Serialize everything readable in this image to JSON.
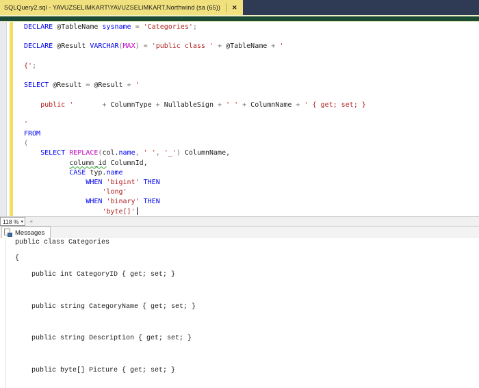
{
  "window": {
    "tab_title": "SQLQuery2.sql - YAVUZSELIMKART\\YAVUZSELIMKART.Northwind (sa (65))",
    "close_glyph": "✕"
  },
  "editor": {
    "zoom_level": "118 %",
    "zoom_dropdown_glyph": "▾",
    "scroll_left_glyph": "◄",
    "lines": [
      [
        {
          "t": "DECLARE",
          "c": "kw"
        },
        {
          "t": " @TableName ",
          "c": "id"
        },
        {
          "t": "sysname",
          "c": "kw"
        },
        {
          "t": " = ",
          "c": "op"
        },
        {
          "t": "'Categories'",
          "c": "str"
        },
        {
          "t": ";",
          "c": "op"
        }
      ],
      [],
      [
        {
          "t": "DECLARE",
          "c": "kw"
        },
        {
          "t": " @Result ",
          "c": "id"
        },
        {
          "t": "VARCHAR",
          "c": "kw"
        },
        {
          "t": "(",
          "c": "op"
        },
        {
          "t": "MAX",
          "c": "fn"
        },
        {
          "t": ") = ",
          "c": "op"
        },
        {
          "t": "'public class '",
          "c": "str"
        },
        {
          "t": " + ",
          "c": "op"
        },
        {
          "t": "@TableName",
          "c": "id"
        },
        {
          "t": " + ",
          "c": "op"
        },
        {
          "t": "'",
          "c": "str"
        }
      ],
      [],
      [
        {
          "t": "{'",
          "c": "str"
        },
        {
          "t": ";",
          "c": "op"
        }
      ],
      [],
      [
        {
          "t": "SELECT",
          "c": "kw"
        },
        {
          "t": " @Result ",
          "c": "id"
        },
        {
          "t": "= ",
          "c": "op"
        },
        {
          "t": "@Result ",
          "c": "id"
        },
        {
          "t": "+ ",
          "c": "op"
        },
        {
          "t": "'",
          "c": "str"
        }
      ],
      [],
      [
        {
          "t": "    public '",
          "c": "str"
        },
        {
          "t": "       + ",
          "c": "op"
        },
        {
          "t": "ColumnType ",
          "c": "id"
        },
        {
          "t": "+ ",
          "c": "op"
        },
        {
          "t": "NullableSign ",
          "c": "id"
        },
        {
          "t": "+ ",
          "c": "op"
        },
        {
          "t": "' '",
          "c": "str"
        },
        {
          "t": " + ",
          "c": "op"
        },
        {
          "t": "ColumnName",
          "c": "id"
        },
        {
          "t": " + ",
          "c": "op"
        },
        {
          "t": "' { get; set; }",
          "c": "str"
        }
      ],
      [],
      [
        {
          "t": "'",
          "c": "str"
        }
      ],
      [
        {
          "t": "FROM",
          "c": "kw"
        }
      ],
      [
        {
          "t": "(",
          "c": "op"
        }
      ],
      [
        {
          "t": "    ",
          "c": "id"
        },
        {
          "t": "SELECT",
          "c": "kw"
        },
        {
          "t": " ",
          "c": "id"
        },
        {
          "t": "REPLACE",
          "c": "fn"
        },
        {
          "t": "(",
          "c": "op"
        },
        {
          "t": "col.",
          "c": "id"
        },
        {
          "t": "name",
          "c": "kw"
        },
        {
          "t": ", ",
          "c": "op"
        },
        {
          "t": "' '",
          "c": "str"
        },
        {
          "t": ", ",
          "c": "op"
        },
        {
          "t": "'_'",
          "c": "str"
        },
        {
          "t": ") ",
          "c": "op"
        },
        {
          "t": "ColumnName,",
          "c": "id"
        }
      ],
      [
        {
          "t": "           ",
          "c": "id"
        },
        {
          "t": "column_id",
          "c": "sq"
        },
        {
          "t": " ColumnId,",
          "c": "id"
        }
      ],
      [
        {
          "t": "           ",
          "c": "id"
        },
        {
          "t": "CASE",
          "c": "kw"
        },
        {
          "t": " typ.",
          "c": "id"
        },
        {
          "t": "name",
          "c": "kw"
        }
      ],
      [
        {
          "t": "               ",
          "c": "id"
        },
        {
          "t": "WHEN",
          "c": "kw"
        },
        {
          "t": " ",
          "c": "id"
        },
        {
          "t": "'bigint'",
          "c": "str"
        },
        {
          "t": " ",
          "c": "id"
        },
        {
          "t": "THEN",
          "c": "kw"
        }
      ],
      [
        {
          "t": "                   ",
          "c": "id"
        },
        {
          "t": "'long'",
          "c": "str"
        }
      ],
      [
        {
          "t": "               ",
          "c": "id"
        },
        {
          "t": "WHEN",
          "c": "kw"
        },
        {
          "t": " ",
          "c": "id"
        },
        {
          "t": "'binary'",
          "c": "str"
        },
        {
          "t": " ",
          "c": "id"
        },
        {
          "t": "THEN",
          "c": "kw"
        }
      ],
      [
        {
          "t": "                   ",
          "c": "id"
        },
        {
          "t": "'byte[]'",
          "c": "str"
        },
        {
          "t": "",
          "c": "caret"
        }
      ]
    ]
  },
  "messages": {
    "tab_label": "Messages",
    "lines": [
      "public class Categories",
      "",
      "{",
      "",
      "    public int CategoryID { get; set; }",
      "",
      "",
      "",
      "    public string CategoryName { get; set; }",
      "",
      "",
      "",
      "    public string Description { get; set; }",
      "",
      "",
      "",
      "    public byte[] Picture { get; set; }"
    ]
  },
  "colors": {
    "tabbar-bg": "#2f3b54",
    "tab-active-bg": "#f0e17e",
    "tab-active-fg": "#1c1c1c",
    "accent-green": "#1b4a35",
    "accent-cream": "#eef0c8",
    "margin-bg": "#e9eaee",
    "changebar": "#f2df61",
    "kw": "#0000ee",
    "str": "#b22222",
    "fn": "#c800c8",
    "op": "#6e6e6e",
    "id": "#1e1e1e",
    "squiggle": "#2da32d"
  }
}
